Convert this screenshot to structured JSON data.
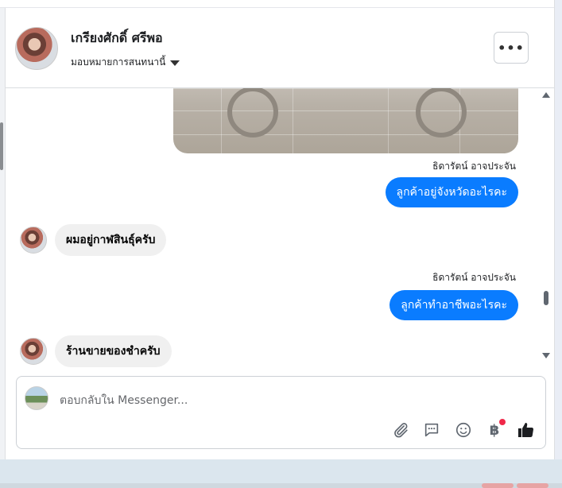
{
  "header": {
    "name": "เกรียงศักดิ์ ศรีพอ",
    "assign_label": "มอบหมายการสนทนานี้",
    "more_label": "•••"
  },
  "messages": [
    {
      "type": "outgoing",
      "sender": "ธิดารัตน์ อาจประจัน",
      "text": "ลูกค้าอยู่จังหวัดอะไรคะ"
    },
    {
      "type": "incoming",
      "text": "ผมอยู่กาฬสินธุ์ครับ"
    },
    {
      "type": "outgoing",
      "sender": "ธิดารัตน์ อาจประจัน",
      "text": "ลูกค้าทำอาชีพอะไรคะ"
    },
    {
      "type": "incoming",
      "text": "ร้านขายของชำครับ"
    }
  ],
  "composer": {
    "placeholder": "ตอบกลับใน Messenger...",
    "tools": [
      "paperclip-icon",
      "chat-bubble-icon",
      "smiley-icon",
      "baht-icon",
      "thumbs-up-icon"
    ],
    "baht_symbol": "฿"
  },
  "colors": {
    "outgoing_bubble": "#0a7cff",
    "incoming_bubble": "#f0f0f0",
    "notification_dot": "#f02849"
  }
}
